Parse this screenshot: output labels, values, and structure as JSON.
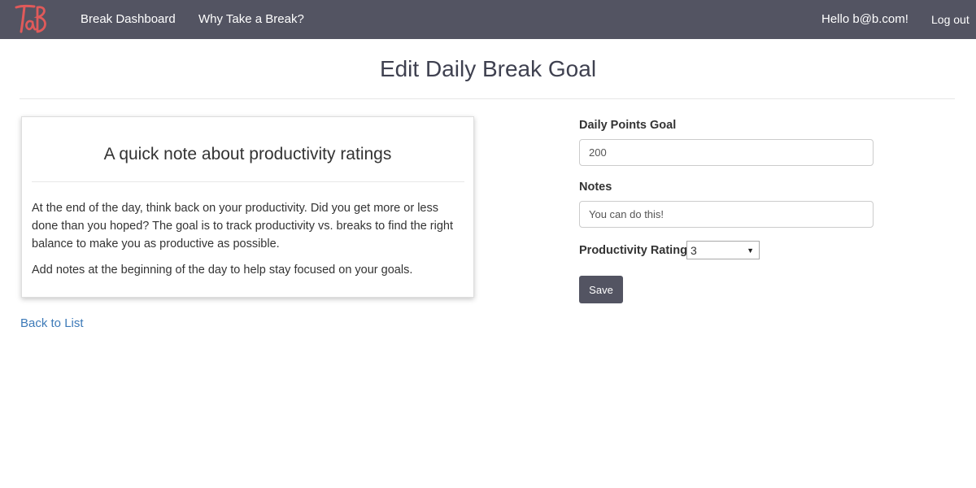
{
  "nav": {
    "logo_text": "TaB",
    "links": {
      "dashboard": "Break Dashboard",
      "why": "Why Take a Break?"
    },
    "greeting": "Hello b@b.com!",
    "logout": "Log out"
  },
  "page": {
    "title": "Edit Daily Break Goal"
  },
  "note": {
    "heading": "A quick note about productivity ratings",
    "paragraph1": "At the end of the day, think back on your productivity. Did you get more or less done than you hoped? The goal is to track productivity vs. breaks to find the right balance to make you as productive as possible.",
    "paragraph2": "Add notes at the beginning of the day to help stay focused on your goals."
  },
  "back_link": "Back to List",
  "form": {
    "goal_label": "Daily Points Goal",
    "goal_value": "200",
    "notes_label": "Notes",
    "notes_value": "You can do this!",
    "rating_label": "Productivity Rating",
    "rating_value": "3",
    "save_label": "Save"
  },
  "colors": {
    "navbar": "#535462",
    "logo": "#e05a5a",
    "link": "#3d7ab8",
    "button": "#535462"
  }
}
